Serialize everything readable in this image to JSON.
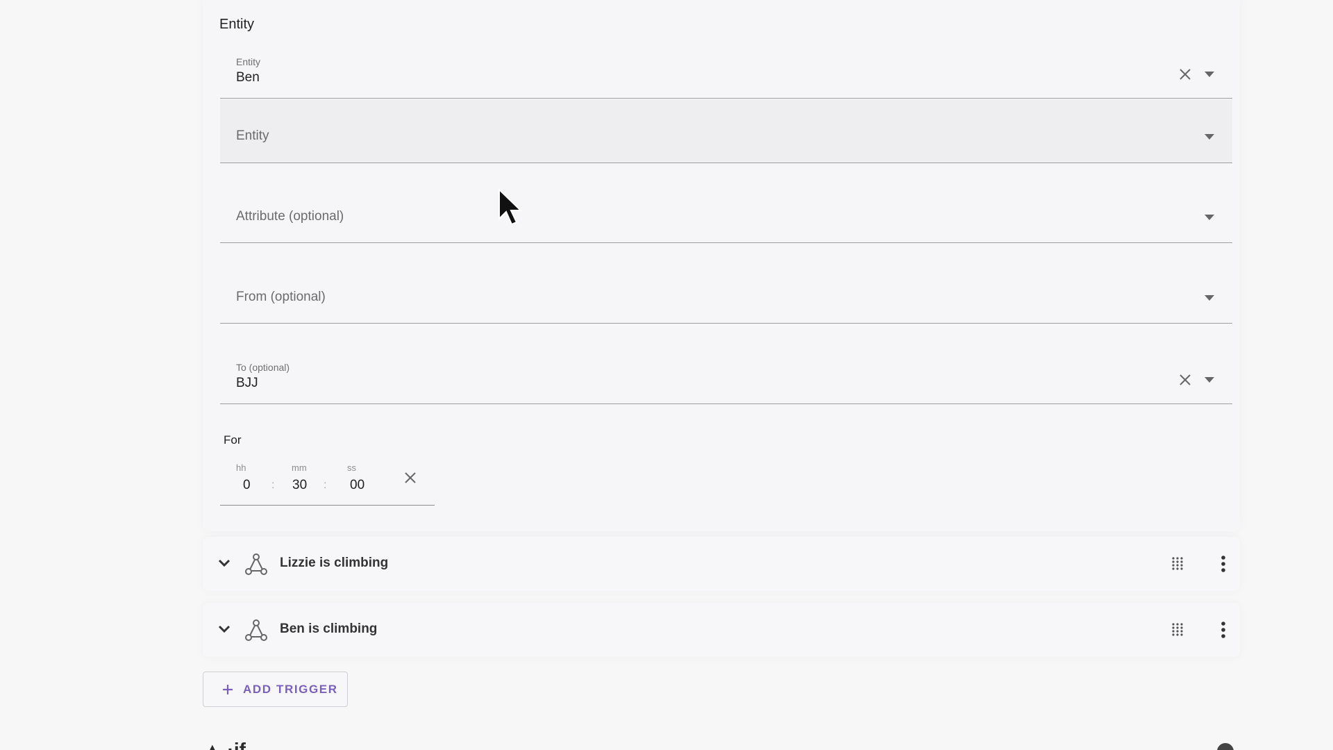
{
  "section": {
    "title": "Entity"
  },
  "fields": {
    "entity_first": {
      "label": "Entity",
      "value": "Ben"
    },
    "entity_second": {
      "placeholder": "Entity"
    },
    "attribute": {
      "placeholder": "Attribute (optional)"
    },
    "from": {
      "placeholder": "From (optional)"
    },
    "to": {
      "label": "To (optional)",
      "value": "BJJ"
    }
  },
  "duration": {
    "label": "For",
    "hh_label": "hh",
    "hh": "0",
    "mm_label": "mm",
    "mm": "30",
    "ss_label": "ss",
    "ss": "00",
    "separator": ":"
  },
  "triggers": [
    {
      "title": "Lizzie is climbing"
    },
    {
      "title": "Ben is climbing"
    }
  ],
  "add_trigger": {
    "label": "ADD TRIGGER"
  },
  "next_section": {
    "partial_title": "▲ ·if"
  },
  "colors": {
    "accent": "#7a5fbe",
    "border": "#9e9e9e",
    "background": "#f7f7f8"
  },
  "icons": [
    "close-icon",
    "caret-down-icon",
    "chevron-down-icon",
    "state-trigger-icon",
    "drag-handle-icon",
    "more-vert-icon",
    "plus-icon",
    "help-icon",
    "mouse-cursor-icon"
  ]
}
